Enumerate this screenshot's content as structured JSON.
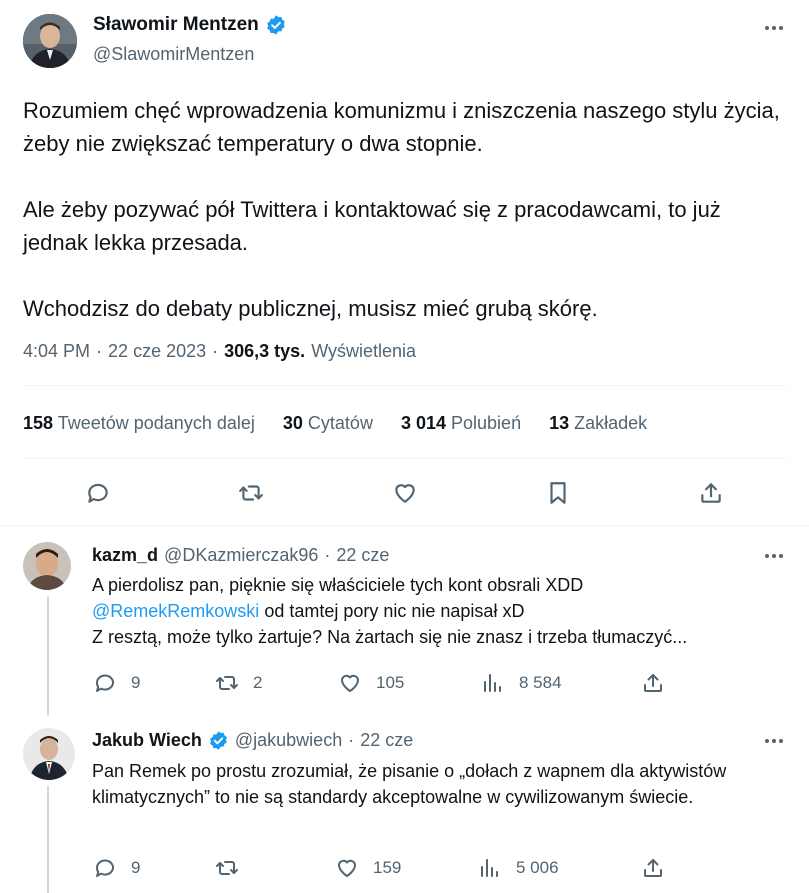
{
  "main_tweet": {
    "author_name": "Sławomir Mentzen",
    "author_handle": "@SlawomirMentzen",
    "paragraphs": [
      "Rozumiem chęć wprowadzenia komunizmu i zniszczenia naszego stylu życia, żeby nie zwiększać temperatury o dwa stopnie.",
      "Ale żeby pozywać pół Twittera i kontaktować się z pracodawcami, to już jednak lekka przesada.",
      "Wchodzisz do debaty publicznej, musisz mieć grubą skórę."
    ],
    "time": "4:04 PM",
    "date": "22 cze 2023",
    "views_count": "306,3 tys.",
    "views_label": "Wyświetlenia",
    "stats": {
      "retweets_count": "158",
      "retweets_label": "Tweetów podanych dalej",
      "quotes_count": "30",
      "quotes_label": "Cytatów",
      "likes_count": "3 014",
      "likes_label": "Polubień",
      "bookmarks_count": "13",
      "bookmarks_label": "Zakładek"
    }
  },
  "replies": [
    {
      "author_name": "kazm_d",
      "author_handle": "@DKazmierczak96",
      "date": "22 cze",
      "line1": "A pierdolisz pan, pięknie się właściciele tych kont obsrali XDD",
      "mention": "@RemekRemkowski",
      "line2_rest": " od tamtej pory nic nie napisał xD",
      "line3": "Z resztą, może tylko żartuje? Na żartach się nie znasz i trzeba tłumaczyć...",
      "replies": "9",
      "retweets": "2",
      "likes": "105",
      "views": "8 584"
    },
    {
      "author_name": "Jakub Wiech",
      "author_handle": "@jakubwiech",
      "date": "22 cze",
      "text": "Pan Remek po prostu zrozumiał, że pisanie o „dołach z wapnem dla aktywistów klimatycznych” to nie są standardy akceptowalne w cywilizowanym świecie.",
      "replies": "9",
      "retweets": "",
      "likes": "159",
      "views": "5 006"
    }
  ],
  "icons": {
    "reply": "reply-icon",
    "retweet": "retweet-icon",
    "like": "heart-icon",
    "bookmark": "bookmark-icon",
    "share": "share-icon",
    "views": "views-icon",
    "verified": "verified-badge-icon",
    "more": "more-icon"
  },
  "colors": {
    "accent": "#1d9bf0",
    "muted": "#536471",
    "text": "#0f1419"
  }
}
